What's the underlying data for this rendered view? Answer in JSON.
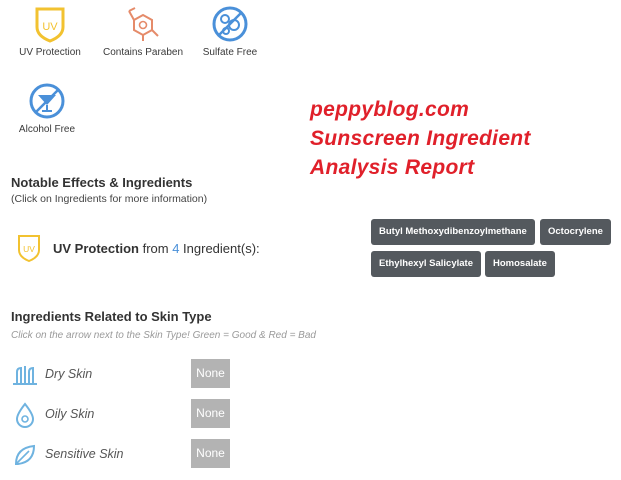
{
  "badges": [
    {
      "label": "UV Protection",
      "icon": "uv-shield-icon"
    },
    {
      "label": "Contains Paraben",
      "icon": "paraben-molecule-icon"
    },
    {
      "label": "Sulfate Free",
      "icon": "sulfate-free-icon"
    },
    {
      "label": "Alcohol Free",
      "icon": "alcohol-free-icon"
    }
  ],
  "uv_badge_text": "UV",
  "watermark": {
    "line1": "peppyblog.com",
    "line2": "Sunscreen Ingredient",
    "line3": "Analysis Report",
    "color": "#e0202a"
  },
  "notable": {
    "title": "Notable Effects & Ingredients",
    "subtitle": "(Click on Ingredients for more information)",
    "effect_name": "UV Protection",
    "from_text": " from ",
    "count": "4",
    "suffix": " Ingredient(s):"
  },
  "ingredients": [
    "Butyl Methoxydibenzoylmethane",
    "Octocrylene",
    "Ethylhexyl Salicylate",
    "Homosalate"
  ],
  "skin": {
    "title": "Ingredients Related to Skin Type",
    "hint": "Click on the arrow next to the Skin Type! Green = Good & Red = Bad",
    "rows": [
      {
        "label": "Dry Skin",
        "value": "None",
        "icon": "dry-skin-icon"
      },
      {
        "label": "Oily Skin",
        "value": "None",
        "icon": "oily-skin-icon"
      },
      {
        "label": "Sensitive Skin",
        "value": "None",
        "icon": "sensitive-skin-icon"
      }
    ]
  },
  "colors": {
    "accent_blue": "#4a90d9",
    "uv_yellow": "#f2c230",
    "paraben_orange": "#e58b6a",
    "chip_bg": "#54595e",
    "none_bg": "#b3b3b3"
  }
}
